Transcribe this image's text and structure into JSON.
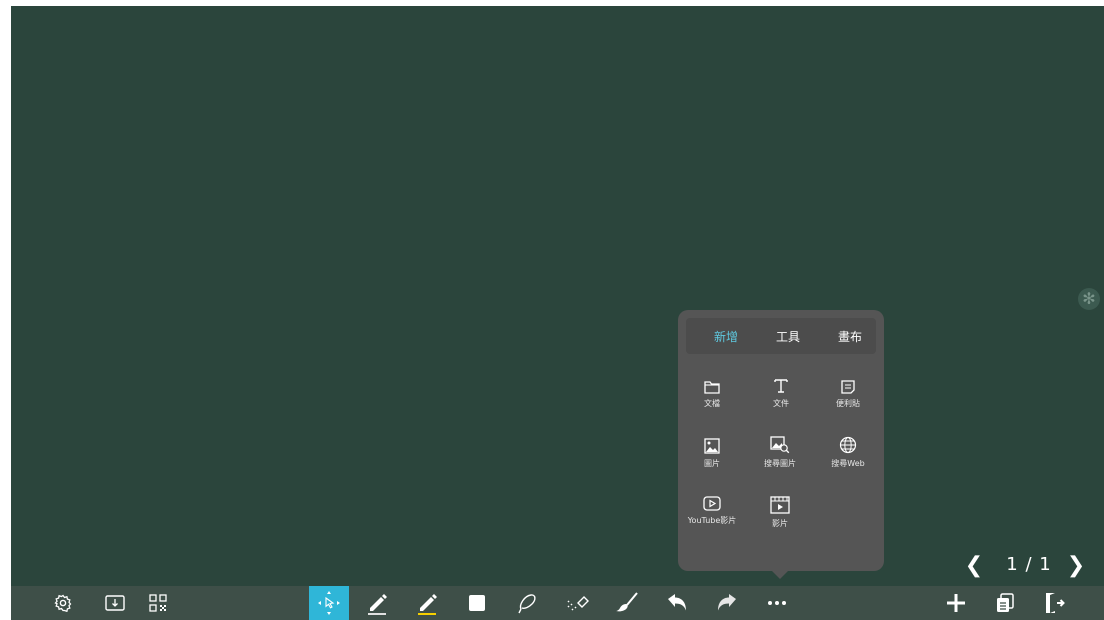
{
  "popup": {
    "tabs": [
      {
        "label": "新增",
        "active": true
      },
      {
        "label": "工具",
        "active": false
      },
      {
        "label": "畫布",
        "active": false
      }
    ],
    "items": [
      {
        "label": "文檔",
        "icon": "folder-icon"
      },
      {
        "label": "文件",
        "icon": "text-icon"
      },
      {
        "label": "便利貼",
        "icon": "sticky-note-icon"
      },
      {
        "label": "圖片",
        "icon": "image-icon"
      },
      {
        "label": "搜尋圖片",
        "icon": "image-search-icon"
      },
      {
        "label": "搜尋Web",
        "icon": "web-search-icon"
      },
      {
        "label": "YouTube影片",
        "icon": "youtube-icon"
      },
      {
        "label": "影片",
        "icon": "video-icon"
      }
    ]
  },
  "pager": {
    "text": "1 / 1"
  },
  "colors": {
    "board": "#2b453c",
    "toolbar": "#3e4f48",
    "popup": "#555555",
    "accent": "#2fb6d8",
    "active_tab": "#5fc9e0",
    "highlighter": "#f5d000"
  },
  "toolbar": {
    "left": [
      "settings-icon",
      "download-folder-icon",
      "qr-code-icon"
    ],
    "center": [
      "select-move-icon",
      "pen-icon",
      "highlighter-icon",
      "shape-icon",
      "lasso-icon",
      "eraser-icon",
      "clear-brush-icon",
      "undo-icon",
      "redo-icon",
      "more-icon"
    ],
    "right": [
      "add-page-icon",
      "pages-icon",
      "exit-icon"
    ]
  }
}
